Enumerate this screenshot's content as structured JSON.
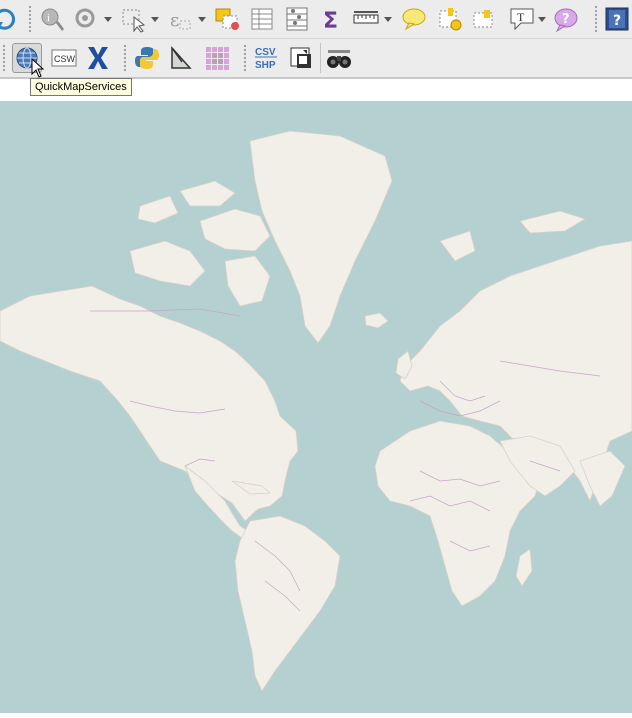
{
  "toolbar_top": {
    "buttons": [
      "refresh-icon",
      "identify-icon",
      "zoom-select-icon",
      "select-features-icon",
      "expression-select-icon",
      "deselect-icon",
      "attribute-table-icon",
      "field-calculator-icon",
      "statistics-icon",
      "measure-icon",
      "map-tips-icon",
      "new-bookmark-icon",
      "show-bookmarks-icon",
      "text-annotation-icon",
      "help-icon",
      "whats-this-icon"
    ]
  },
  "toolbar_plugins": {
    "buttons": [
      "quickmapservices-icon",
      "csw-icon",
      "xyz-tools-icon",
      "python-console-icon",
      "digitizing-icon",
      "grid-plugin-icon",
      "csv-shp-icon",
      "map-swipe-icon",
      "binoculars-icon"
    ],
    "csw_label": "CSW",
    "csv_label": "CSV",
    "shp_label": "SHP"
  },
  "tooltip": {
    "text": "QuickMapServices"
  },
  "map": {
    "water_color": "#b5d0d0",
    "land_color": "#f2efe9",
    "border_color": "#c9a3c9"
  }
}
